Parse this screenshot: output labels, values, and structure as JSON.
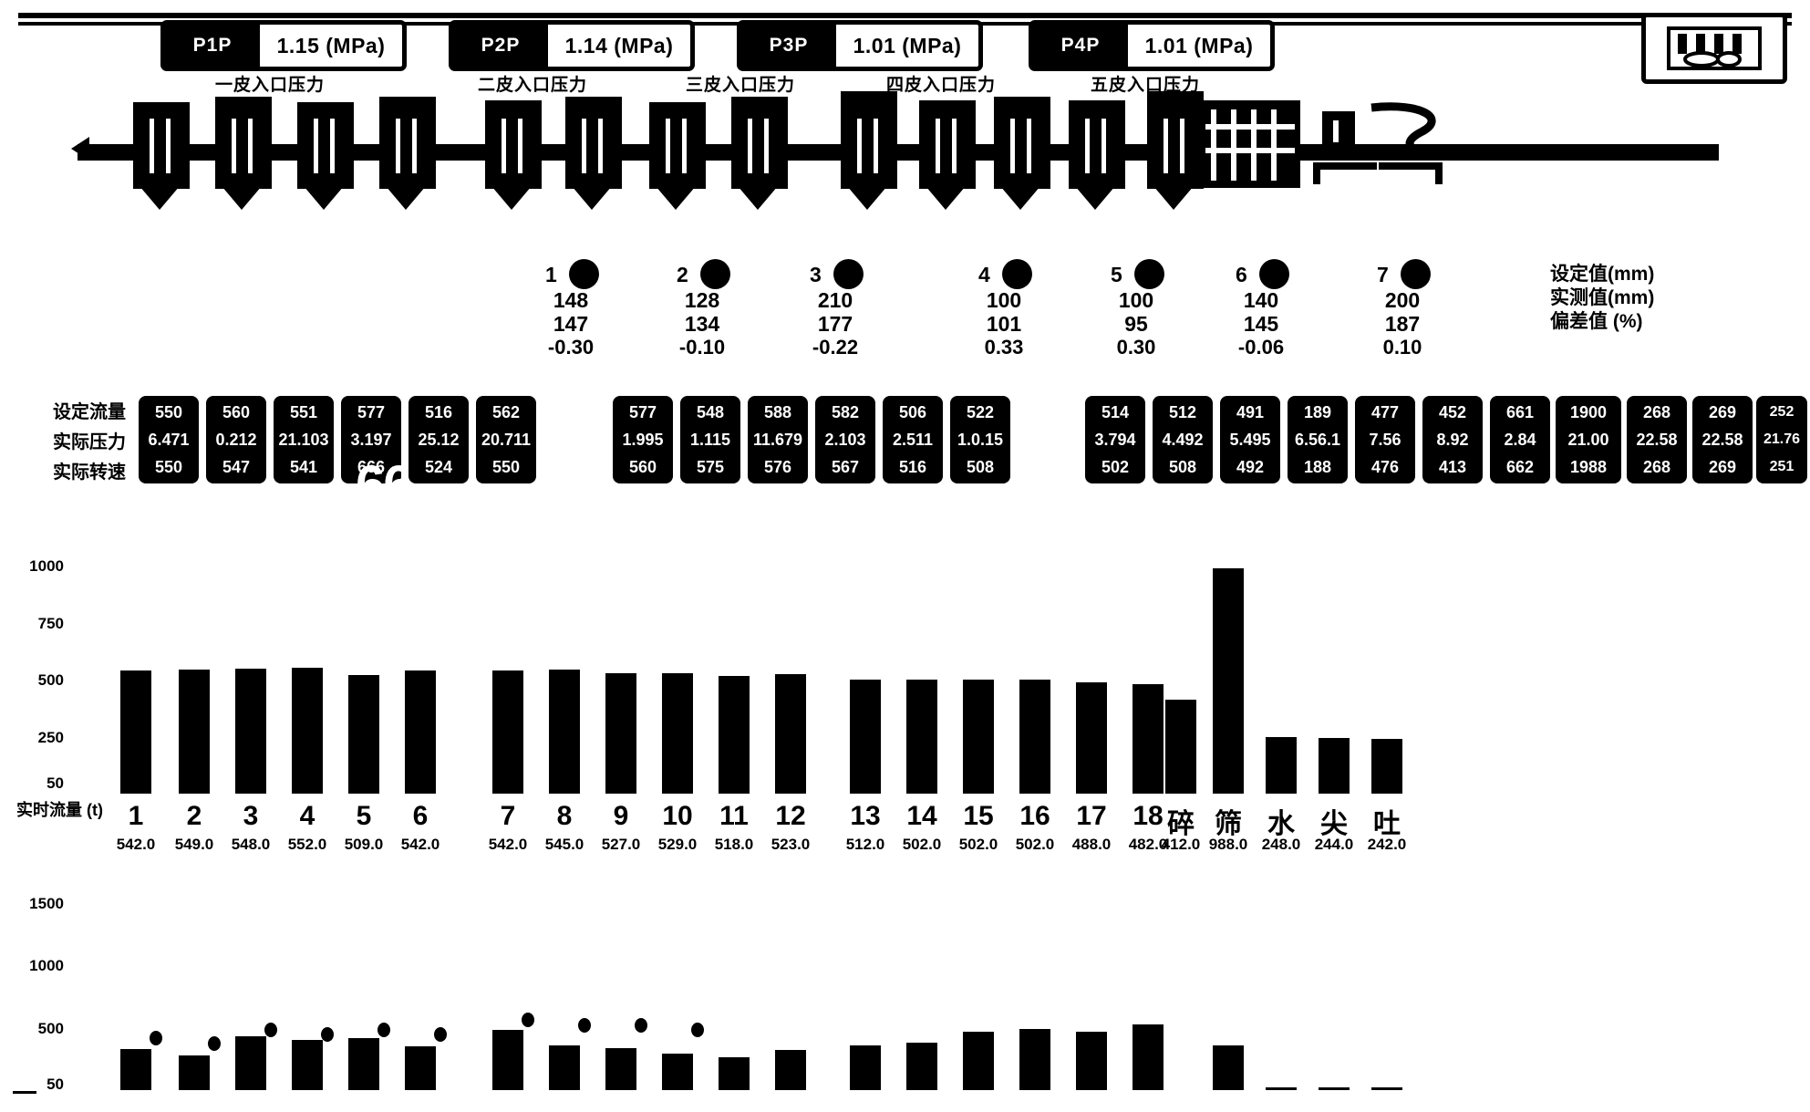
{
  "header": {
    "pressure_panels": [
      {
        "tag": "P1P",
        "value": "1.15 (MPa)",
        "caption": "一皮入口压力"
      },
      {
        "tag": "P2P",
        "value": "1.14 (MPa)",
        "caption": "二皮入口压力"
      },
      {
        "tag": "P3P",
        "value": "1.01 (MPa)",
        "caption": "三皮入口压力"
      },
      {
        "tag": "P4P",
        "value": "1.01 (MPa)",
        "caption": "四皮入口压力"
      }
    ],
    "logo_icon": "mill-machine-icon"
  },
  "sensors": {
    "unit_legend": [
      "设定值(mm)",
      "实测值(mm)",
      "偏差值 (%)"
    ],
    "items": [
      {
        "id": "1",
        "setpoint": "148",
        "actual": "147",
        "deviation": "-0.30"
      },
      {
        "id": "2",
        "setpoint": "128",
        "actual": "134",
        "deviation": "-0.10"
      },
      {
        "id": "3",
        "setpoint": "210",
        "actual": "177",
        "deviation": "-0.22"
      },
      {
        "id": "4",
        "setpoint": "100",
        "actual": "101",
        "deviation": "0.33"
      },
      {
        "id": "5",
        "setpoint": "100",
        "actual": "95",
        "deviation": "0.30"
      },
      {
        "id": "6",
        "setpoint": "140",
        "actual": "145",
        "deviation": "-0.06"
      },
      {
        "id": "7",
        "setpoint": "200",
        "actual": "187",
        "deviation": "0.10"
      }
    ]
  },
  "table": {
    "row_labels": [
      "设定流量",
      "实际压力",
      "实际转速"
    ],
    "groups": [
      {
        "cells": [
          {
            "r1": "550",
            "r2": "6.471",
            "r3": "550"
          },
          {
            "r1": "560",
            "r2": "0.212",
            "r3": "547"
          },
          {
            "r1": "551",
            "r2": "21.103",
            "r3": "541"
          },
          {
            "r1": "577",
            "r2": "3.197",
            "r3": "666",
            "overlay": "666"
          },
          {
            "r1": "516",
            "r2": "25.12",
            "r3": "524"
          },
          {
            "r1": "562",
            "r2": "20.711",
            "r3": "550"
          }
        ]
      },
      {
        "cells": [
          {
            "r1": "577",
            "r2": "1.995",
            "r3": "560"
          },
          {
            "r1": "548",
            "r2": "1.115",
            "r3": "575"
          },
          {
            "r1": "588",
            "r2": "11.679",
            "r3": "576"
          },
          {
            "r1": "582",
            "r2": "2.103",
            "r3": "567"
          },
          {
            "r1": "506",
            "r2": "2.511",
            "r3": "516"
          },
          {
            "r1": "522",
            "r2": "1.0.15",
            "r3": "508"
          }
        ]
      },
      {
        "cells": [
          {
            "r1": "514",
            "r2": "3.794",
            "r3": "502"
          },
          {
            "r1": "512",
            "r2": "4.492",
            "r3": "508"
          },
          {
            "r1": "491",
            "r2": "5.495",
            "r3": "492"
          },
          {
            "r1": "189",
            "r2": "6.56.1",
            "r3": "188"
          },
          {
            "r1": "477",
            "r2": "7.56",
            "r3": "476"
          },
          {
            "r1": "452",
            "r2": "8.92",
            "r3": "413"
          },
          {
            "r1": "661",
            "r2": "2.84",
            "r3": "662"
          },
          {
            "r1": "1900",
            "r2": "21.00",
            "r3": "1988"
          },
          {
            "r1": "268",
            "r2": "22.58",
            "r3": "268"
          },
          {
            "r1": "269",
            "r2": "22.58",
            "r3": "269"
          },
          {
            "r1": "252",
            "r2": "21.76",
            "r3": "251"
          }
        ]
      }
    ]
  },
  "chart_data": [
    {
      "type": "bar",
      "title": "",
      "ylabel": "实时流量 (t)",
      "ylim": [
        0,
        1000
      ],
      "yticks": [
        1000,
        750,
        500,
        250,
        50
      ],
      "grid": false,
      "categories": [
        "1",
        "2",
        "3",
        "4",
        "5",
        "6",
        "7",
        "8",
        "9",
        "10",
        "11",
        "12",
        "13",
        "14",
        "15",
        "16",
        "17",
        "18",
        "碎",
        "筛",
        "水",
        "尖",
        "吐"
      ],
      "value_labels": [
        "542.0",
        "549.0",
        "548.0",
        "552.0",
        "509.0",
        "542.0",
        "542.0",
        "545.0",
        "527.0",
        "529.0",
        "518.0",
        "523.0",
        "512.0",
        "502.0",
        "502.0",
        "502.0",
        "488.0",
        "482.0",
        "412.0",
        "988.0",
        "248.0",
        "244.0",
        "242.0"
      ],
      "values": [
        540,
        545,
        548,
        552,
        520,
        542,
        542,
        545,
        527,
        529,
        518,
        523,
        500,
        502,
        502,
        502,
        488,
        482,
        412,
        988,
        248,
        244,
        242
      ]
    },
    {
      "type": "bar",
      "title": "",
      "ylabel": "",
      "ylim": [
        0,
        1500
      ],
      "yticks": [
        1500,
        1000,
        500,
        50
      ],
      "grid": false,
      "categories": [
        "1",
        "2",
        "3",
        "4",
        "5",
        "6",
        "7",
        "8",
        "9",
        "10",
        "11",
        "12",
        "13",
        "14",
        "15",
        "16",
        "17",
        "18",
        "碎",
        "筛",
        "水",
        "尖",
        "吐"
      ],
      "values": [
        330,
        280,
        430,
        400,
        420,
        350,
        480,
        360,
        340,
        290,
        260,
        320,
        360,
        380,
        470,
        490,
        470,
        530,
        0,
        360,
        25,
        25,
        20
      ],
      "markers": [
        420,
        370,
        480,
        450,
        480,
        450,
        560,
        520,
        520,
        480,
        0,
        0,
        0,
        0,
        0,
        0,
        0,
        0,
        0,
        0,
        0,
        0,
        0
      ]
    }
  ],
  "colors": {
    "accent": "#000000",
    "background": "#ffffff",
    "panel": "#000000"
  }
}
